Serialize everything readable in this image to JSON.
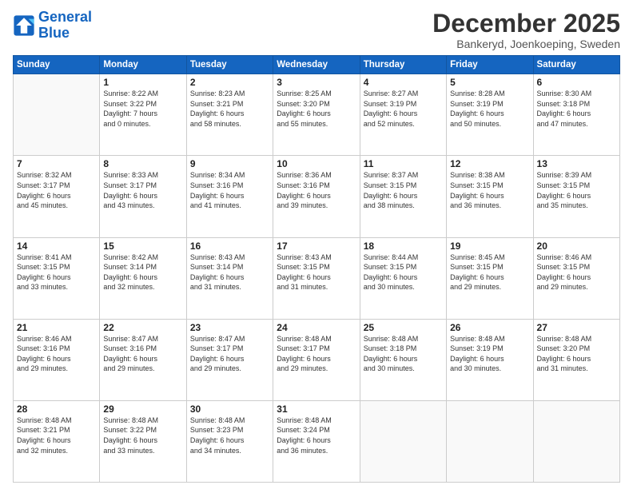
{
  "logo": {
    "line1": "General",
    "line2": "Blue"
  },
  "title": "December 2025",
  "subtitle": "Bankeryd, Joenkoeping, Sweden",
  "days_of_week": [
    "Sunday",
    "Monday",
    "Tuesday",
    "Wednesday",
    "Thursday",
    "Friday",
    "Saturday"
  ],
  "weeks": [
    [
      {
        "day": "",
        "info": ""
      },
      {
        "day": "1",
        "info": "Sunrise: 8:22 AM\nSunset: 3:22 PM\nDaylight: 7 hours\nand 0 minutes."
      },
      {
        "day": "2",
        "info": "Sunrise: 8:23 AM\nSunset: 3:21 PM\nDaylight: 6 hours\nand 58 minutes."
      },
      {
        "day": "3",
        "info": "Sunrise: 8:25 AM\nSunset: 3:20 PM\nDaylight: 6 hours\nand 55 minutes."
      },
      {
        "day": "4",
        "info": "Sunrise: 8:27 AM\nSunset: 3:19 PM\nDaylight: 6 hours\nand 52 minutes."
      },
      {
        "day": "5",
        "info": "Sunrise: 8:28 AM\nSunset: 3:19 PM\nDaylight: 6 hours\nand 50 minutes."
      },
      {
        "day": "6",
        "info": "Sunrise: 8:30 AM\nSunset: 3:18 PM\nDaylight: 6 hours\nand 47 minutes."
      }
    ],
    [
      {
        "day": "7",
        "info": "Sunrise: 8:32 AM\nSunset: 3:17 PM\nDaylight: 6 hours\nand 45 minutes."
      },
      {
        "day": "8",
        "info": "Sunrise: 8:33 AM\nSunset: 3:17 PM\nDaylight: 6 hours\nand 43 minutes."
      },
      {
        "day": "9",
        "info": "Sunrise: 8:34 AM\nSunset: 3:16 PM\nDaylight: 6 hours\nand 41 minutes."
      },
      {
        "day": "10",
        "info": "Sunrise: 8:36 AM\nSunset: 3:16 PM\nDaylight: 6 hours\nand 39 minutes."
      },
      {
        "day": "11",
        "info": "Sunrise: 8:37 AM\nSunset: 3:15 PM\nDaylight: 6 hours\nand 38 minutes."
      },
      {
        "day": "12",
        "info": "Sunrise: 8:38 AM\nSunset: 3:15 PM\nDaylight: 6 hours\nand 36 minutes."
      },
      {
        "day": "13",
        "info": "Sunrise: 8:39 AM\nSunset: 3:15 PM\nDaylight: 6 hours\nand 35 minutes."
      }
    ],
    [
      {
        "day": "14",
        "info": "Sunrise: 8:41 AM\nSunset: 3:15 PM\nDaylight: 6 hours\nand 33 minutes."
      },
      {
        "day": "15",
        "info": "Sunrise: 8:42 AM\nSunset: 3:14 PM\nDaylight: 6 hours\nand 32 minutes."
      },
      {
        "day": "16",
        "info": "Sunrise: 8:43 AM\nSunset: 3:14 PM\nDaylight: 6 hours\nand 31 minutes."
      },
      {
        "day": "17",
        "info": "Sunrise: 8:43 AM\nSunset: 3:15 PM\nDaylight: 6 hours\nand 31 minutes."
      },
      {
        "day": "18",
        "info": "Sunrise: 8:44 AM\nSunset: 3:15 PM\nDaylight: 6 hours\nand 30 minutes."
      },
      {
        "day": "19",
        "info": "Sunrise: 8:45 AM\nSunset: 3:15 PM\nDaylight: 6 hours\nand 29 minutes."
      },
      {
        "day": "20",
        "info": "Sunrise: 8:46 AM\nSunset: 3:15 PM\nDaylight: 6 hours\nand 29 minutes."
      }
    ],
    [
      {
        "day": "21",
        "info": "Sunrise: 8:46 AM\nSunset: 3:16 PM\nDaylight: 6 hours\nand 29 minutes."
      },
      {
        "day": "22",
        "info": "Sunrise: 8:47 AM\nSunset: 3:16 PM\nDaylight: 6 hours\nand 29 minutes."
      },
      {
        "day": "23",
        "info": "Sunrise: 8:47 AM\nSunset: 3:17 PM\nDaylight: 6 hours\nand 29 minutes."
      },
      {
        "day": "24",
        "info": "Sunrise: 8:48 AM\nSunset: 3:17 PM\nDaylight: 6 hours\nand 29 minutes."
      },
      {
        "day": "25",
        "info": "Sunrise: 8:48 AM\nSunset: 3:18 PM\nDaylight: 6 hours\nand 30 minutes."
      },
      {
        "day": "26",
        "info": "Sunrise: 8:48 AM\nSunset: 3:19 PM\nDaylight: 6 hours\nand 30 minutes."
      },
      {
        "day": "27",
        "info": "Sunrise: 8:48 AM\nSunset: 3:20 PM\nDaylight: 6 hours\nand 31 minutes."
      }
    ],
    [
      {
        "day": "28",
        "info": "Sunrise: 8:48 AM\nSunset: 3:21 PM\nDaylight: 6 hours\nand 32 minutes."
      },
      {
        "day": "29",
        "info": "Sunrise: 8:48 AM\nSunset: 3:22 PM\nDaylight: 6 hours\nand 33 minutes."
      },
      {
        "day": "30",
        "info": "Sunrise: 8:48 AM\nSunset: 3:23 PM\nDaylight: 6 hours\nand 34 minutes."
      },
      {
        "day": "31",
        "info": "Sunrise: 8:48 AM\nSunset: 3:24 PM\nDaylight: 6 hours\nand 36 minutes."
      },
      {
        "day": "",
        "info": ""
      },
      {
        "day": "",
        "info": ""
      },
      {
        "day": "",
        "info": ""
      }
    ]
  ]
}
